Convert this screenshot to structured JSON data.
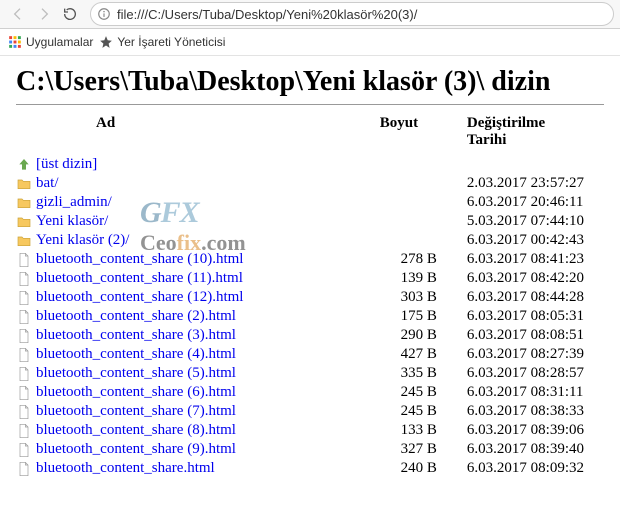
{
  "toolbar": {
    "address": "file:///C:/Users/Tuba/Desktop/Yeni%20klasör%20(3)/"
  },
  "bookmarks": {
    "apps_label": "Uygulamalar",
    "bookmark_mgr": "Yer İşareti Yöneticisi"
  },
  "page": {
    "title": "C:\\Users\\Tuba\\Desktop\\Yeni klasör (3)\\ dizin",
    "columns": {
      "name": "Ad",
      "size": "Boyut",
      "date": "Değiştirilme Tarihi"
    },
    "parent_label": "[üst dizin]"
  },
  "entries": [
    {
      "kind": "up",
      "name": "[üst dizin]",
      "size": "",
      "date": ""
    },
    {
      "kind": "folder",
      "name": "bat/",
      "size": "",
      "date": "2.03.2017 23:57:27"
    },
    {
      "kind": "folder",
      "name": "gizli_admin/",
      "size": "",
      "date": "6.03.2017 20:46:11"
    },
    {
      "kind": "folder",
      "name": "Yeni klasör/",
      "size": "",
      "date": "5.03.2017 07:44:10"
    },
    {
      "kind": "folder",
      "name": "Yeni klasör (2)/",
      "size": "",
      "date": "6.03.2017 00:42:43"
    },
    {
      "kind": "file",
      "name": "bluetooth_content_share (10).html",
      "size": "278 B",
      "date": "6.03.2017 08:41:23"
    },
    {
      "kind": "file",
      "name": "bluetooth_content_share (11).html",
      "size": "139 B",
      "date": "6.03.2017 08:42:20"
    },
    {
      "kind": "file",
      "name": "bluetooth_content_share (12).html",
      "size": "303 B",
      "date": "6.03.2017 08:44:28"
    },
    {
      "kind": "file",
      "name": "bluetooth_content_share (2).html",
      "size": "175 B",
      "date": "6.03.2017 08:05:31"
    },
    {
      "kind": "file",
      "name": "bluetooth_content_share (3).html",
      "size": "290 B",
      "date": "6.03.2017 08:08:51"
    },
    {
      "kind": "file",
      "name": "bluetooth_content_share (4).html",
      "size": "427 B",
      "date": "6.03.2017 08:27:39"
    },
    {
      "kind": "file",
      "name": "bluetooth_content_share (5).html",
      "size": "335 B",
      "date": "6.03.2017 08:28:57"
    },
    {
      "kind": "file",
      "name": "bluetooth_content_share (6).html",
      "size": "245 B",
      "date": "6.03.2017 08:31:11"
    },
    {
      "kind": "file",
      "name": "bluetooth_content_share (7).html",
      "size": "245 B",
      "date": "6.03.2017 08:38:33"
    },
    {
      "kind": "file",
      "name": "bluetooth_content_share (8).html",
      "size": "133 B",
      "date": "6.03.2017 08:39:06"
    },
    {
      "kind": "file",
      "name": "bluetooth_content_share (9).html",
      "size": "327 B",
      "date": "6.03.2017 08:39:40"
    },
    {
      "kind": "file",
      "name": "bluetooth_content_share.html",
      "size": "240 B",
      "date": "6.03.2017 08:09:32"
    }
  ],
  "watermark": {
    "line1_a": "G",
    "line1_b": "FX",
    "line2_a": "Ceo",
    "line2_b": "fix",
    "line2_c": ".com"
  }
}
